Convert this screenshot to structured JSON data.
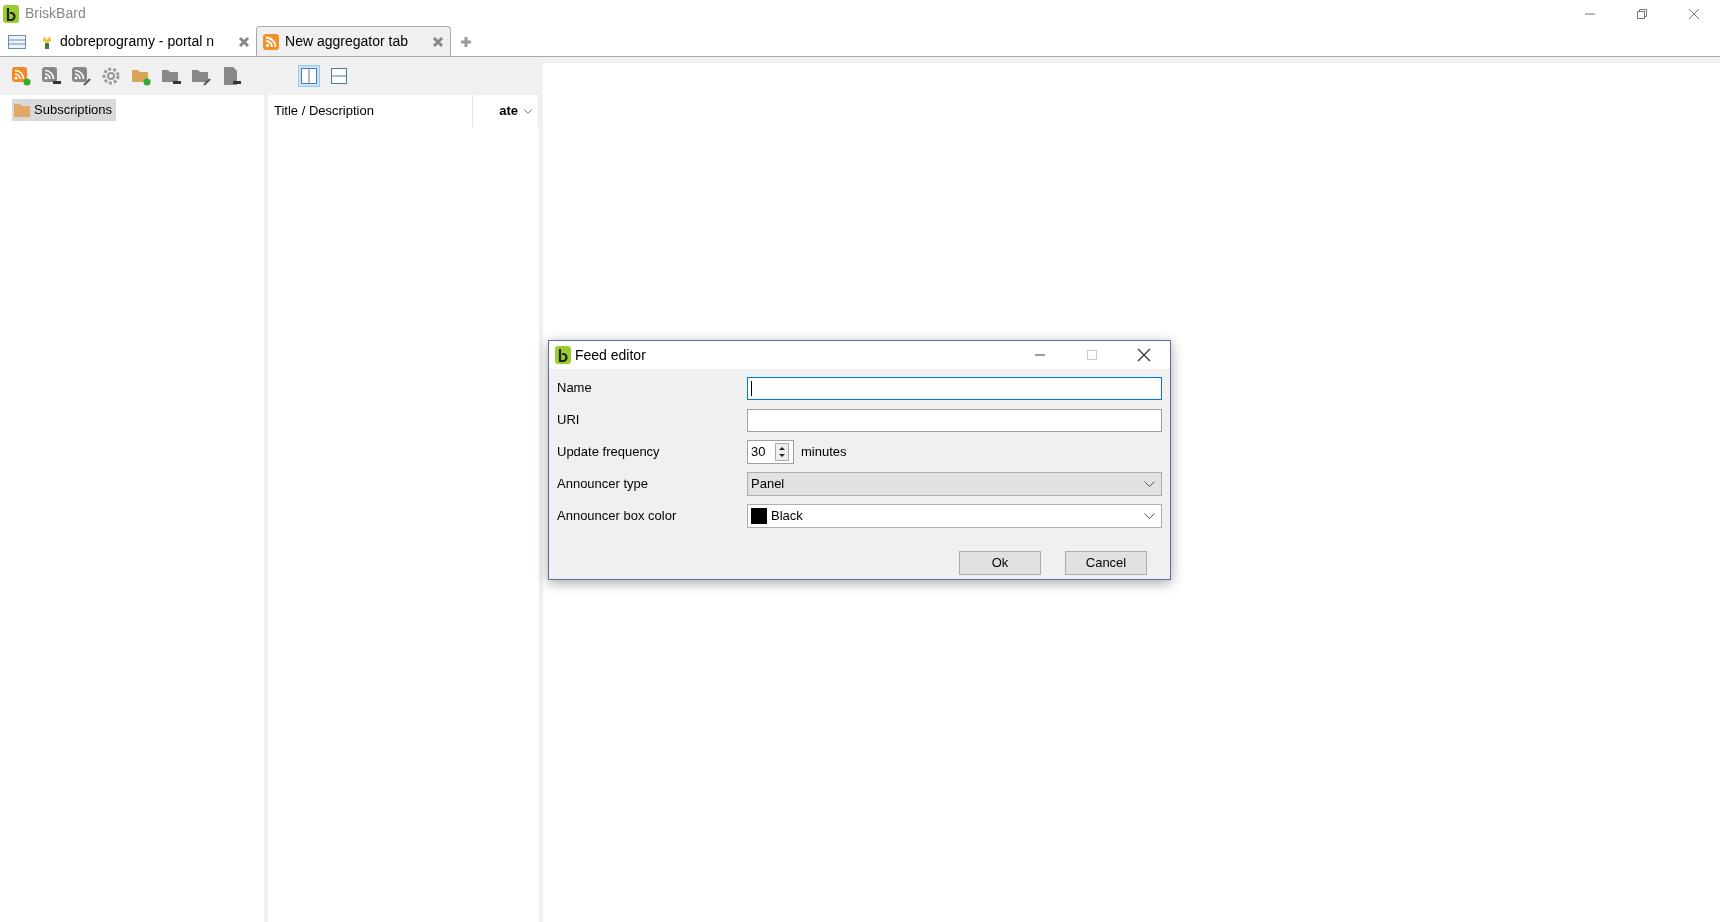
{
  "window": {
    "title": "BriskBard"
  },
  "tabs": [
    {
      "label": "dobreprogramy - portal n",
      "kind": "web",
      "selected": false
    },
    {
      "label": "New aggregator tab",
      "kind": "feed",
      "selected": true
    }
  ],
  "layout_buttons": [
    {
      "kind": "columns",
      "selected": true
    },
    {
      "kind": "rows",
      "selected": false
    }
  ],
  "tree": [
    {
      "label": "Subscriptions",
      "selected": true
    }
  ],
  "list": {
    "columns": [
      {
        "label": "Title / Description",
        "kind": "title"
      },
      {
        "label": "ate",
        "kind": "date"
      }
    ]
  },
  "dialog": {
    "title": "Feed editor",
    "fields": [
      {
        "label": "Name",
        "kind": "text",
        "focused": true
      },
      {
        "label": "URI",
        "kind": "text",
        "focused": false
      },
      {
        "label": "Update frequency",
        "kind": "spin",
        "value": "30",
        "suffix": "minutes"
      },
      {
        "label": "Announcer type",
        "kind": "select",
        "value": "Panel"
      },
      {
        "label": "Announcer box color",
        "kind": "color",
        "value": "Black",
        "color": "#000000"
      }
    ],
    "buttons": [
      "Ok",
      "Cancel"
    ]
  }
}
